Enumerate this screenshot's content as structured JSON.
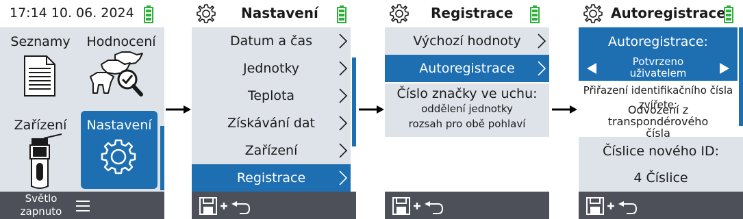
{
  "screen1": {
    "status_time": "17:14 10. 06. 2024",
    "tiles": [
      {
        "label": "Seznamy"
      },
      {
        "label": "Hodnocení"
      },
      {
        "label": "Zařízení"
      },
      {
        "label": "Nastavení"
      }
    ],
    "footer_label_line1": "Světlo",
    "footer_label_line2": "zapnuto"
  },
  "screen2": {
    "title": "Nastavení",
    "items": [
      {
        "label": "Datum a čas"
      },
      {
        "label": "Jednotky"
      },
      {
        "label": "Teplota"
      },
      {
        "label": "Získávání dat"
      },
      {
        "label": "Zařízení"
      },
      {
        "label": "Registrace"
      }
    ],
    "selected_index": 5
  },
  "screen3": {
    "title": "Registrace",
    "items": [
      {
        "label": "Výchozí hodnoty"
      },
      {
        "label": "Autoregistrace"
      }
    ],
    "ear_tag_heading": "Číslo značky ve uchu:",
    "ear_tag_line1": "oddělení jednotky",
    "ear_tag_line2": "rozsah pro obě pohlaví"
  },
  "screen4": {
    "title": "Autoregistrace",
    "setting_label": "Autoregistrace:",
    "setting_value_line1": "Potvrzeno",
    "setting_value_line2": "uživatelem",
    "assign_heading_line1": "Přiřazení identifikačního čísla",
    "assign_heading_line2": "zvířete:",
    "assign_value_line1": "Odvození z",
    "assign_value_line2": "transpondérového",
    "assign_value_line3": "čísla",
    "digits_label": "Číslice nového ID:",
    "digits_value": "4 Číslice"
  },
  "colors": {
    "accent": "#1e6eb2",
    "item_bg": "#dde3e9",
    "footer_bg": "#4d5058",
    "battery_green": "#2db03a"
  },
  "icons": [
    "gear-icon",
    "battery-icon",
    "chevron-right-icon",
    "save-icon",
    "back-icon",
    "menu-icon",
    "list-document-icon",
    "cows-search-icon",
    "reader-device-icon",
    "right-arrow-icon"
  ]
}
